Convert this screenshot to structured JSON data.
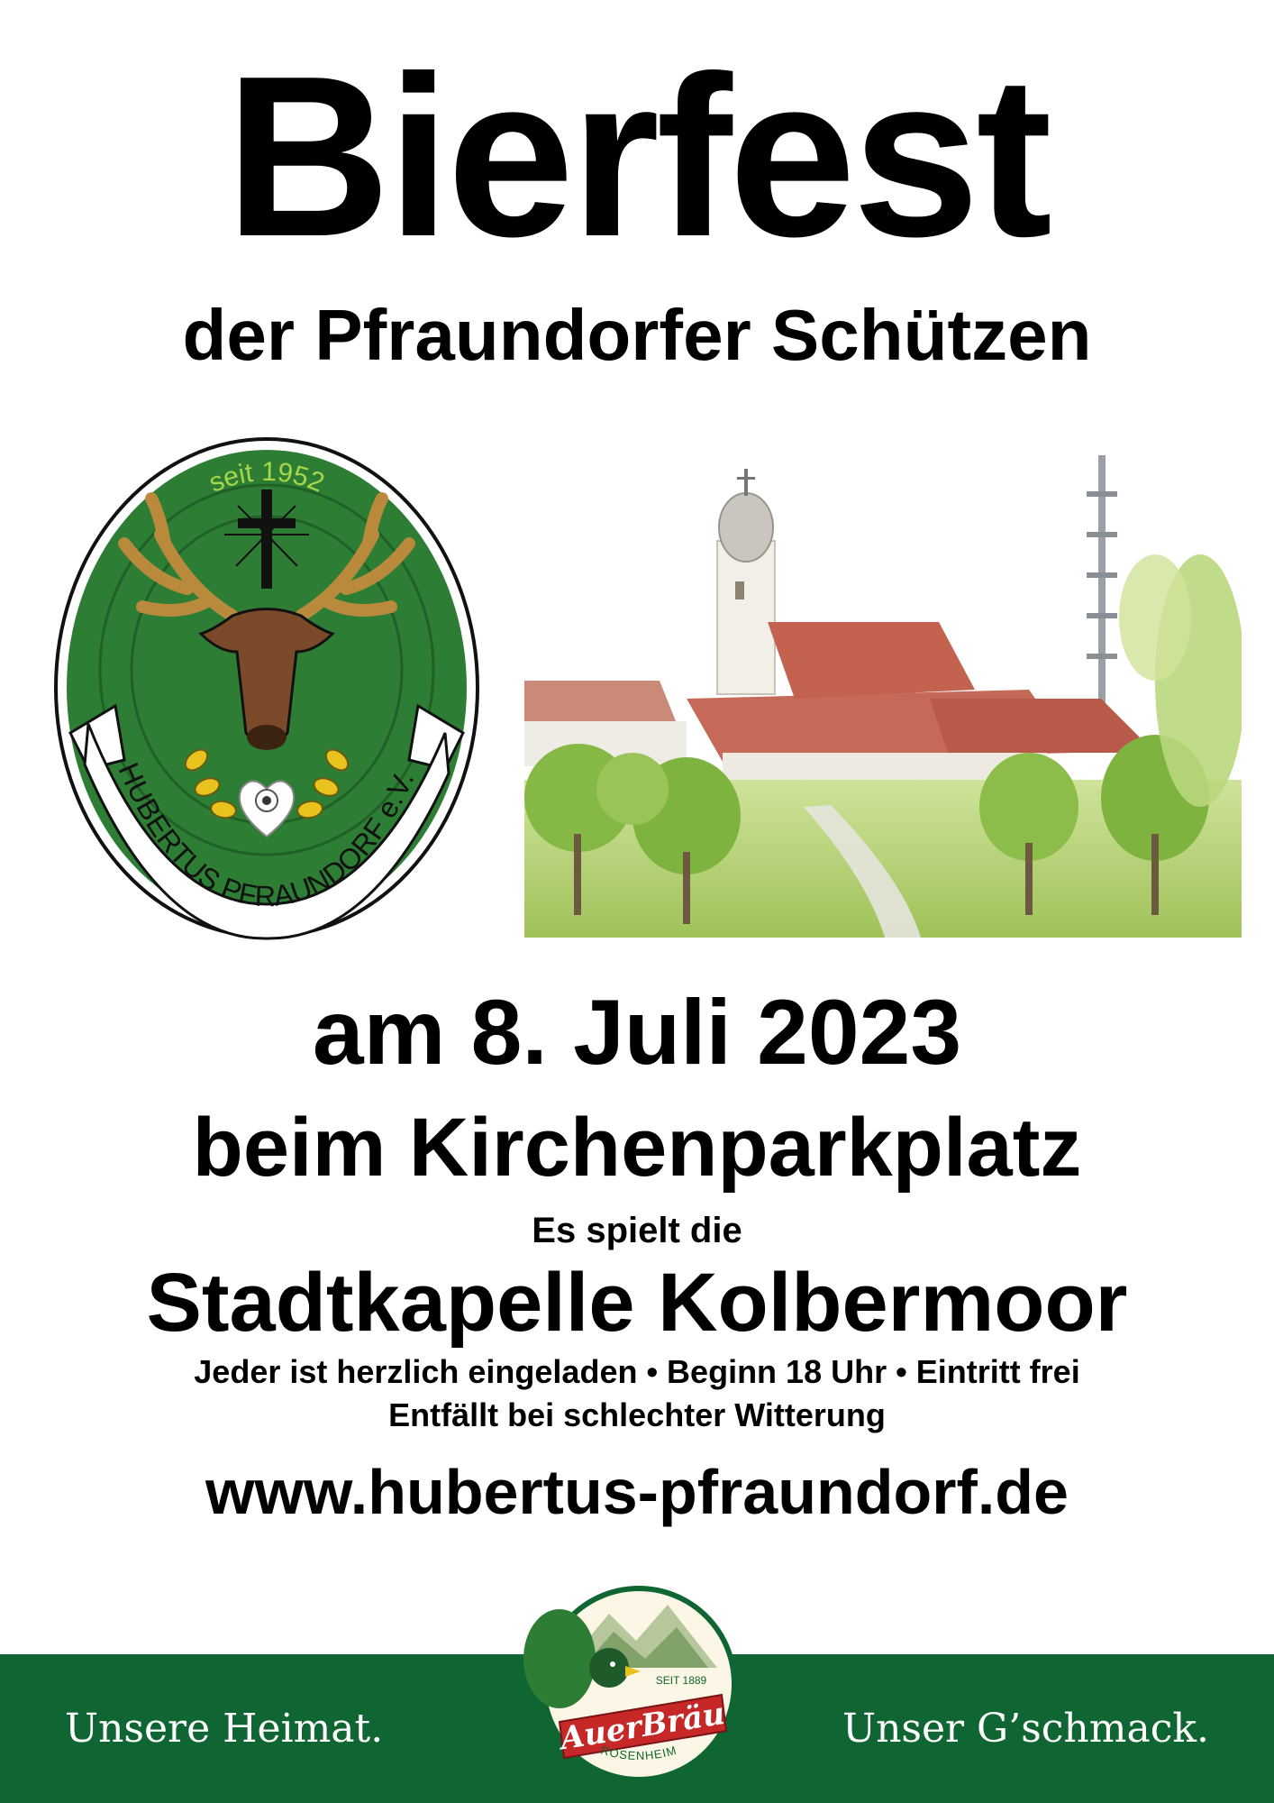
{
  "poster": {
    "title": "Bierfest",
    "subtitle": "der Pfraundorfer Schützen",
    "date": "am 8. Juli 2023",
    "location": "beim Kirchenparkplatz",
    "plays_intro": "Es spielt die",
    "band": "Stadtkapelle Kolbermoor",
    "info_line": "Jeder ist herzlich eingeladen • Beginn 18 Uhr • Eintritt frei",
    "weather_note": "Entfällt bei schlechter Witterung",
    "website": "www.hubertus-pfraundorf.de"
  },
  "club_logo": {
    "top_text": "seit 1952",
    "ribbon_text": "HUBERTUS PFRAUNDORF e.V.",
    "icon": "stag-cross-emblem",
    "colors": {
      "green": "#2e7d34",
      "brown": "#7a4a2a",
      "gold": "#e8c21d"
    }
  },
  "illustration": {
    "icon": "village-church-maypole-watercolor"
  },
  "sponsor": {
    "slogan_left": "Unsere Heimat.",
    "slogan_right": "Unser G’schmack.",
    "brand": "AuerBräu",
    "since": "SEIT 1889",
    "city": "ROSENHEIM",
    "band_color": "#0f6633",
    "brand_color": "#c62828"
  }
}
